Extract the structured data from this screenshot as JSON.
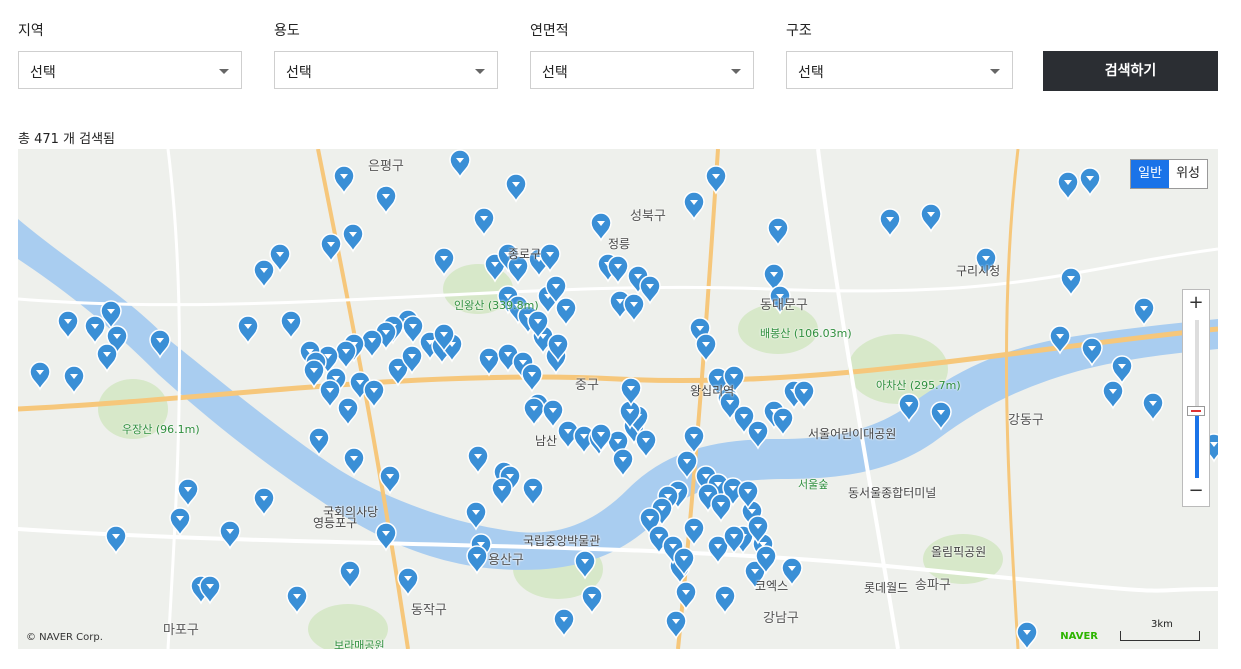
{
  "filters": {
    "region": {
      "label": "지역",
      "value": "선택"
    },
    "usage": {
      "label": "용도",
      "value": "선택"
    },
    "area": {
      "label": "연면적",
      "value": "선택"
    },
    "structure": {
      "label": "구조",
      "value": "선택"
    },
    "search_label": "검색하기"
  },
  "result_count_text": "총 471 개 검색됨",
  "map": {
    "type_toggle": [
      "일반",
      "위성"
    ],
    "selected_type": "일반",
    "zoom_in": "+",
    "zoom_out": "−",
    "zoom_level_fraction": 0.42,
    "copyright": "© NAVER Corp.",
    "brand": "NAVER",
    "scale_label": "3km",
    "marker_color": "#3a8fd6",
    "districts": [
      "은평구",
      "성북구",
      "중구",
      "동대문구",
      "강동구",
      "동작구",
      "강남구",
      "송파구",
      "영등포구",
      "마포구",
      "용산구",
      "종로구"
    ],
    "places": [
      "인왕산 (339.8m)",
      "배봉산 (106.03m)",
      "아차산 (295.7m)",
      "우장산 (96.1m)",
      "국회의사당",
      "국립중앙박물관",
      "올림픽공원",
      "롯데월드",
      "코엑스",
      "서울숲",
      "남산",
      "보라매공원",
      "서울어린이대공원",
      "동서울종합터미널",
      "왕십리역",
      "정릉",
      "구리시청"
    ]
  }
}
